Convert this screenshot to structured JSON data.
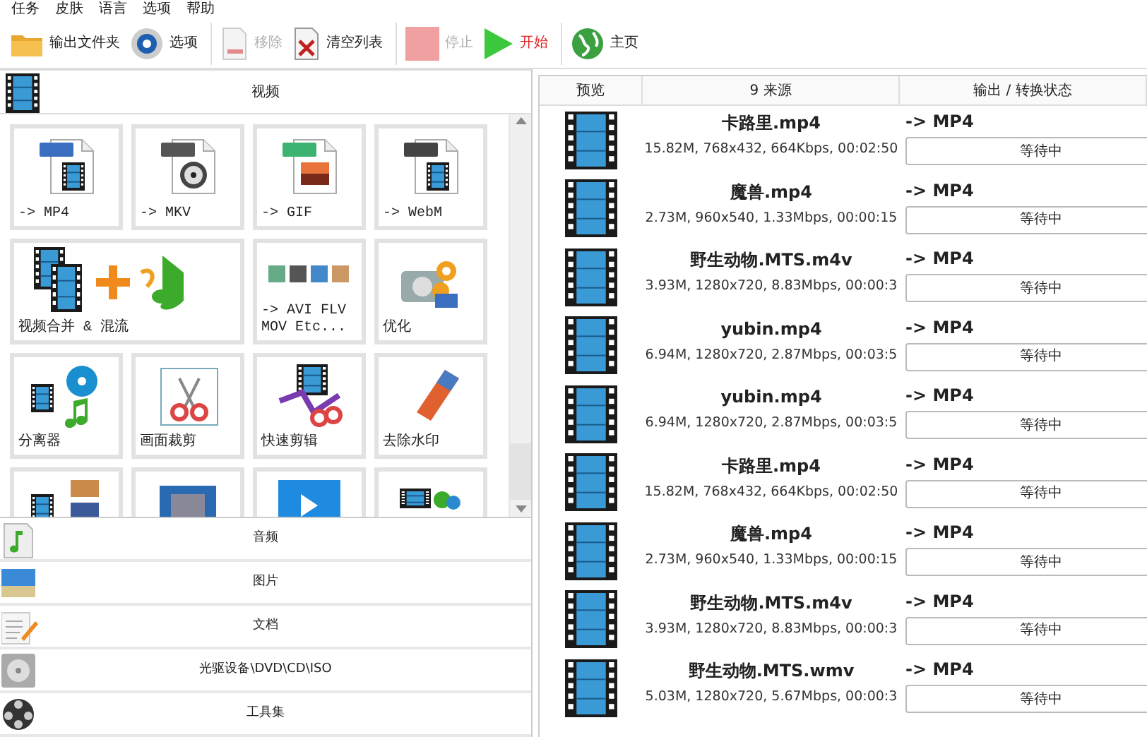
{
  "menu": [
    "任务",
    "皮肤",
    "语言",
    "选项",
    "帮助"
  ],
  "toolbar": [
    {
      "label": "输出文件夹",
      "kind": "folder",
      "disabled": false
    },
    {
      "label": "选项",
      "kind": "gear",
      "disabled": false
    },
    {
      "label": "移除",
      "kind": "remove",
      "disabled": true
    },
    {
      "label": "清空列表",
      "kind": "clear",
      "disabled": false
    },
    {
      "label": "停止",
      "kind": "stop",
      "disabled": true
    },
    {
      "label": "开始",
      "kind": "start",
      "disabled": false
    },
    {
      "label": "主页",
      "kind": "globe",
      "disabled": false
    }
  ],
  "video_section": {
    "title": "视频",
    "tiles": [
      {
        "label": "-> MP4",
        "kind": "mp4"
      },
      {
        "label": "-> MKV",
        "kind": "mkv"
      },
      {
        "label": "-> GIF",
        "kind": "gif"
      },
      {
        "label": "-> WebM",
        "kind": "webm"
      },
      {
        "label": "视频合并 & 混流",
        "kind": "merge",
        "wide": true
      },
      {
        "label": "-> AVI FLV\nMOV Etc...",
        "kind": "formats"
      },
      {
        "label": "优化",
        "kind": "optimize"
      },
      {
        "label": "分离器",
        "kind": "splitter"
      },
      {
        "label": "画面裁剪",
        "kind": "crop"
      },
      {
        "label": "快速剪辑",
        "kind": "clip"
      },
      {
        "label": "去除水印",
        "kind": "logo"
      },
      {
        "kind": "split-pictures"
      },
      {
        "kind": "screen"
      },
      {
        "kind": "player"
      },
      {
        "kind": "download"
      }
    ]
  },
  "categories": [
    {
      "label": "音频",
      "kind": "audio"
    },
    {
      "label": "图片",
      "kind": "picture"
    },
    {
      "label": "文档",
      "kind": "document"
    },
    {
      "label": "光驱设备\\DVD\\CD\\ISO",
      "kind": "disc"
    },
    {
      "label": "工具集",
      "kind": "tools"
    }
  ],
  "file_list": {
    "columns": [
      "预览",
      "9 来源",
      "输出 / 转换状态"
    ],
    "rows": [
      {
        "name": "卡路里.mp4",
        "info": "15.82M, 768x432, 664Kbps, 00:02:50",
        "output": "-> MP4",
        "status": "等待中"
      },
      {
        "name": "魔兽.mp4",
        "info": "2.73M, 960x540, 1.33Mbps, 00:00:15",
        "output": "-> MP4",
        "status": "等待中"
      },
      {
        "name": "野生动物.MTS.m4v",
        "info": "3.93M, 1280x720, 8.83Mbps, 00:00:3",
        "output": "-> MP4",
        "status": "等待中"
      },
      {
        "name": "yubin.mp4",
        "info": "6.94M, 1280x720, 2.87Mbps, 00:03:5",
        "output": "-> MP4",
        "status": "等待中"
      },
      {
        "name": "yubin.mp4",
        "info": "6.94M, 1280x720, 2.87Mbps, 00:03:5",
        "output": "-> MP4",
        "status": "等待中"
      },
      {
        "name": "卡路里.mp4",
        "info": "15.82M, 768x432, 664Kbps, 00:02:50",
        "output": "-> MP4",
        "status": "等待中"
      },
      {
        "name": "魔兽.mp4",
        "info": "2.73M, 960x540, 1.33Mbps, 00:00:15",
        "output": "-> MP4",
        "status": "等待中"
      },
      {
        "name": "野生动物.MTS.m4v",
        "info": "3.93M, 1280x720, 8.83Mbps, 00:00:3",
        "output": "-> MP4",
        "status": "等待中"
      },
      {
        "name": "野生动物.MTS.wmv",
        "info": "5.03M, 1280x720, 5.67Mbps, 00:00:3",
        "output": "-> MP4",
        "status": "等待中"
      }
    ]
  }
}
